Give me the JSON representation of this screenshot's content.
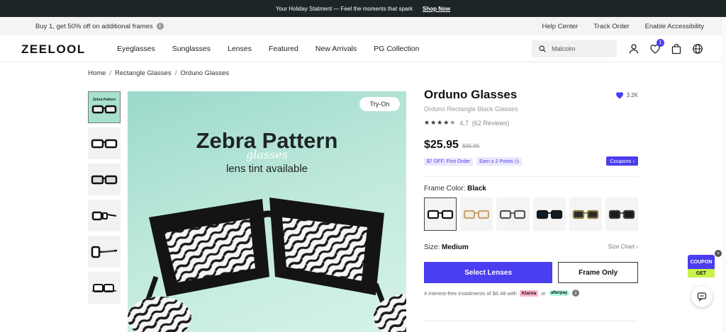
{
  "announcement": {
    "text": "Your Holiday Statment — Feel the moments that spark",
    "link": "Shop Now"
  },
  "promo_bar": {
    "left_text": "Buy 1, get 50% off on additional frames",
    "info": "i",
    "links": [
      "Help Center",
      "Track Order",
      "Enable Accessibility"
    ]
  },
  "nav": {
    "logo": "ZEELOOL",
    "items": [
      "Eyeglasses",
      "Sunglasses",
      "Lenses",
      "Featured",
      "New Arrivals",
      "PG Collection"
    ],
    "search_value": "Malcolm",
    "wishlist_count": "1",
    "icons": [
      "account-icon",
      "wishlist-heart-icon",
      "shopping-bag-icon",
      "globe-icon"
    ]
  },
  "breadcrumb": [
    "Home",
    "Rectangle Glasses",
    "Orduno Glasses"
  ],
  "gallery": {
    "try_on": "Try-On",
    "hero_title": "Zebra Pattern",
    "hero_script": "glasses",
    "hero_subtitle": "lens tint available",
    "thumb_caption": "Zebra Pattern"
  },
  "product": {
    "name": "Orduno Glasses",
    "likes": "3.2K",
    "subtitle": "Orduno Rectangle Black Glasses",
    "rating": "4.7",
    "rating_stars": 4.7,
    "reviews": "(62 Reviews)",
    "price": "$25.95",
    "old_price": "$35.95",
    "offer_1": "$7 OFF; First Order",
    "offer_2": "Earn ≥ 2 Points",
    "coupons_label": "Coupons",
    "frame_color_label": "Frame Color:",
    "frame_color_value": "Black",
    "size_label": "Size:",
    "size_value": "Medium",
    "size_chart": "Size Chart",
    "select_lenses": "Select Lenses",
    "frame_only": "Frame Only",
    "installments": "4 interest-free instalments of $6.48 with",
    "klarna": "Klarna",
    "or": "or",
    "afterpay": "afterpay"
  },
  "swatches": [
    {
      "frame": "#111111",
      "lens": "#ffffff"
    },
    {
      "frame": "#c9a36b",
      "lens": "#f3efe6"
    },
    {
      "frame": "#555555",
      "lens": "#f3f3f3"
    },
    {
      "frame": "#151515",
      "lens": "#0c1c28"
    },
    {
      "frame": "#8a7a3e",
      "lens": "#2a2a2a"
    },
    {
      "frame": "#3a3a3a",
      "lens": "#1a1a1a"
    }
  ],
  "floating": {
    "coupon_top": "COUPON",
    "coupon_bottom": "GET",
    "close": "×"
  },
  "colors": {
    "accent": "#4b3df0",
    "announcement_bg": "#1d2526",
    "hero_bg": "#bfe9dc"
  }
}
